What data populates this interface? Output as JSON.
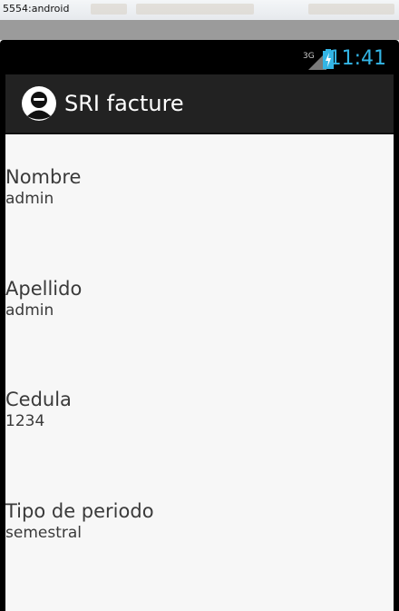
{
  "host": {
    "title": "5554:android"
  },
  "status_bar": {
    "network": "3G",
    "time": "11:41",
    "signal_icon": "signal-bars-icon",
    "battery_icon": "battery-charging-icon"
  },
  "action_bar": {
    "title": "SRI facture",
    "app_icon": "app-logo-icon"
  },
  "fields": [
    {
      "label": "Nombre",
      "value": "admin"
    },
    {
      "label": "Apellido",
      "value": "admin"
    },
    {
      "label": "Cedula",
      "value": "1234"
    },
    {
      "label": "Tipo de periodo",
      "value": "semestral"
    }
  ],
  "colors": {
    "clock": "#33b5e5",
    "action_bar": "#222222",
    "content_bg": "#f7f7f7"
  }
}
